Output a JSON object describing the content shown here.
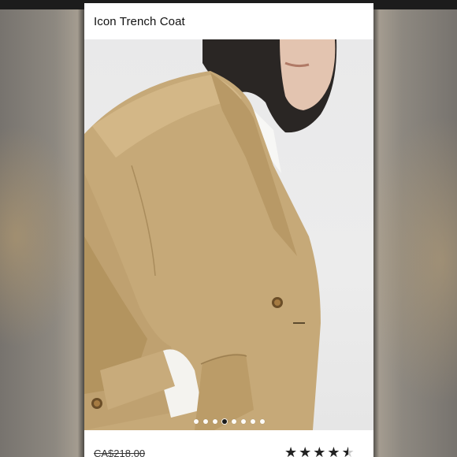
{
  "product": {
    "title": "Icon Trench Coat",
    "original_price": "CA$218.00",
    "rating": 4.5,
    "rating_max": 5
  },
  "gallery": {
    "image_count": 8,
    "active_index": 3
  },
  "icons": {
    "star": "star-icon"
  },
  "colors": {
    "coat": "#c6a978",
    "background": "#ffffff",
    "active_dot": "#1a1a1a"
  }
}
